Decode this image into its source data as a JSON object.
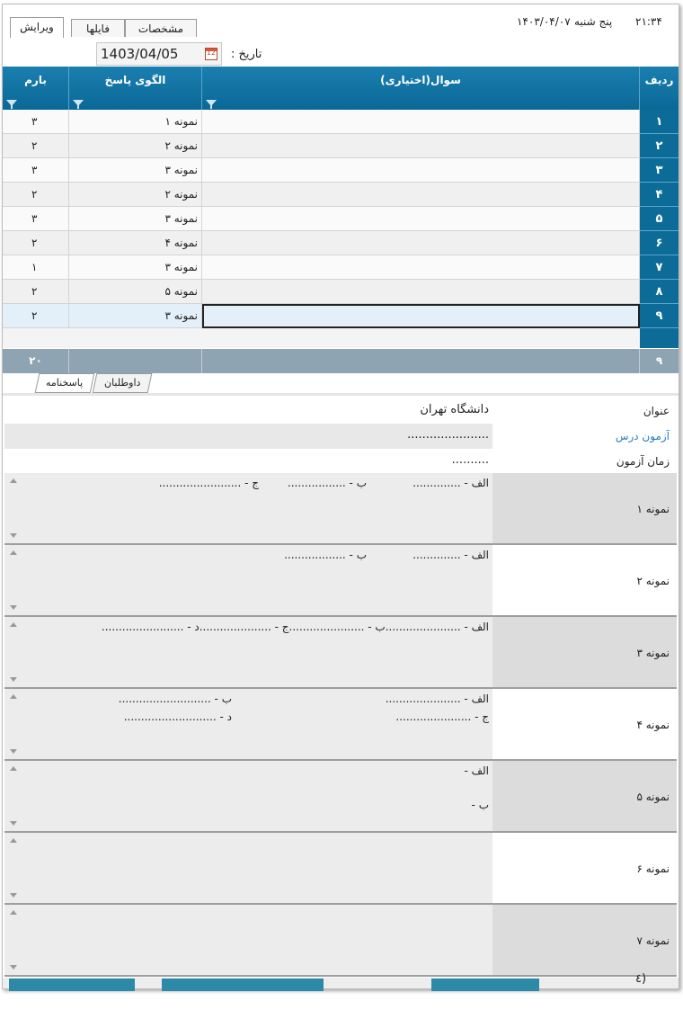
{
  "header": {
    "time": "۲۱:۳۴",
    "day": "پنج شنبه",
    "date": "۱۴۰۳/۰۴/۰۷",
    "tabs": [
      "ویرایش",
      "فایلها",
      "مشخصات"
    ]
  },
  "date_field": {
    "label": "تاریخ :",
    "value": "1403/04/05"
  },
  "grid": {
    "columns": [
      "ردیف",
      "سوال(اختیاری)",
      "الگوی پاسخ",
      "بارم"
    ],
    "rows": [
      {
        "num": "۱",
        "pattern": "نمونه ۱",
        "score": "۳"
      },
      {
        "num": "۲",
        "pattern": "نمونه ۲",
        "score": "۲"
      },
      {
        "num": "۳",
        "pattern": "نمونه ۳",
        "score": "۳"
      },
      {
        "num": "۴",
        "pattern": "نمونه ۲",
        "score": "۲"
      },
      {
        "num": "۵",
        "pattern": "نمونه ۳",
        "score": "۳"
      },
      {
        "num": "۶",
        "pattern": "نمونه ۴",
        "score": "۲"
      },
      {
        "num": "۷",
        "pattern": "نمونه ۳",
        "score": "۱"
      },
      {
        "num": "۸",
        "pattern": "نمونه ۵",
        "score": "۲"
      },
      {
        "num": "۹",
        "pattern": "نمونه ۳",
        "score": "۲"
      }
    ],
    "footer": {
      "count": "۹",
      "total": "۲۰"
    }
  },
  "bottom_tabs": [
    "داوطلبان",
    "پاسخنامه"
  ],
  "form": {
    "title_label": "عنوان",
    "title_value": "دانشگاه تهران",
    "course_label": "آزمون درس",
    "course_value": "......................",
    "time_label": "زمان آزمون",
    "time_value": "..........",
    "samples": [
      {
        "label": "نمونه ۱",
        "l1": "الف - ..............",
        "l2": "ب - .................",
        "l3": "ج - ........................"
      },
      {
        "label": "نمونه ۲",
        "l1": "الف - ..............",
        "l2": "ب - .................."
      },
      {
        "label": "نمونه ۳",
        "l1": "الف - ......................ب - ......................ج - .....................د - ........................"
      },
      {
        "label": "نمونه ۴",
        "l1": "الف - ......................",
        "l2": "ب - ...........................",
        "l3": "ج - ......................",
        "l4": "د - ..........................."
      },
      {
        "label": "نمونه ۵",
        "l1": "الف -",
        "l2": "ب -"
      },
      {
        "label": "نمونه ۶"
      },
      {
        "label": "نمونه ۷"
      }
    ],
    "partial": "(٤"
  },
  "colors": {
    "accent": "#0d6b98",
    "footer": "#8ea4b2",
    "label_bg": "#dcdcdc"
  }
}
